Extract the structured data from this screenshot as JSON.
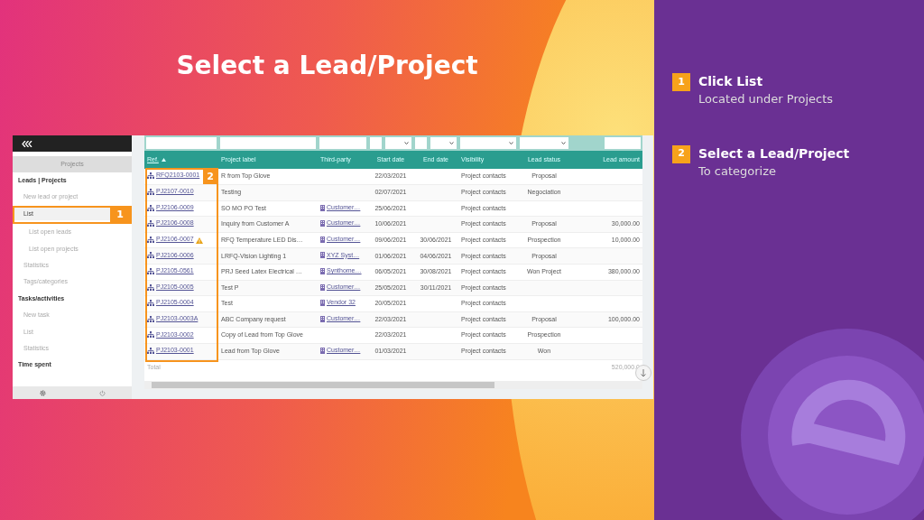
{
  "slide_title": "Select a Lead/Project",
  "sidebar": {
    "header": "Projects",
    "items": [
      {
        "kind": "section",
        "label": "Leads | Projects",
        "selected": false
      },
      {
        "kind": "item",
        "label": "New lead or project",
        "selected": false
      },
      {
        "kind": "item",
        "label": "List",
        "selected": true
      },
      {
        "kind": "subitem",
        "label": "List open leads",
        "selected": false
      },
      {
        "kind": "subitem",
        "label": "List open projects",
        "selected": false
      },
      {
        "kind": "item",
        "label": "Statistics",
        "selected": false
      },
      {
        "kind": "item",
        "label": "Tags/categories",
        "selected": false
      },
      {
        "kind": "section",
        "label": "Tasks/activities",
        "selected": false
      },
      {
        "kind": "item",
        "label": "New task",
        "selected": false
      },
      {
        "kind": "item",
        "label": "List",
        "selected": false
      },
      {
        "kind": "item",
        "label": "Statistics",
        "selected": false
      },
      {
        "kind": "section",
        "label": "Time spent",
        "selected": false
      }
    ]
  },
  "callouts": [
    {
      "number": "1"
    },
    {
      "number": "2"
    }
  ],
  "table": {
    "filters": [
      {
        "kind": "text"
      },
      {
        "kind": "text"
      },
      {
        "kind": "text"
      },
      {
        "kind": "date"
      },
      {
        "kind": "date"
      },
      {
        "kind": "select"
      },
      {
        "kind": "select"
      },
      {
        "kind": "text"
      }
    ],
    "columns": [
      {
        "label": "Ref.",
        "sorted": true
      },
      {
        "label": "Project label",
        "sorted": false
      },
      {
        "label": "Third-party",
        "sorted": false
      },
      {
        "label": "Start date",
        "sorted": false
      },
      {
        "label": "End date",
        "sorted": false
      },
      {
        "label": "Visibility",
        "sorted": false
      },
      {
        "label": "Lead status",
        "sorted": false
      },
      {
        "label": "Lead amount",
        "sorted": false
      }
    ],
    "rows": [
      {
        "ref": "RFQ2103-0001",
        "warning": false,
        "label": "R from Top Glove",
        "third_party": "",
        "start": "22/03/2021",
        "end": "",
        "visibility": "Project contacts",
        "status": "Proposal",
        "amount": ""
      },
      {
        "ref": "PJ2107-0010",
        "warning": false,
        "label": "Testing",
        "third_party": "",
        "start": "02/07/2021",
        "end": "",
        "visibility": "Project contacts",
        "status": "Negociation",
        "amount": ""
      },
      {
        "ref": "PJ2106-0009",
        "warning": false,
        "label": "SO MO PO Test",
        "third_party": "Customer…",
        "start": "25/06/2021",
        "end": "",
        "visibility": "Project contacts",
        "status": "",
        "amount": ""
      },
      {
        "ref": "PJ2106-0008",
        "warning": false,
        "label": "Inquiry from Customer A",
        "third_party": "Customer…",
        "start": "10/06/2021",
        "end": "",
        "visibility": "Project contacts",
        "status": "Proposal",
        "amount": "30,000.00"
      },
      {
        "ref": "PJ2106-0007",
        "warning": true,
        "label": "RFQ Temperature LED Dis…",
        "third_party": "Customer…",
        "start": "09/06/2021",
        "end": "30/06/2021",
        "visibility": "Project contacts",
        "status": "Prospection",
        "amount": "10,000.00"
      },
      {
        "ref": "PJ2106-0006",
        "warning": false,
        "label": "LRFQ-Vision Lighting 1",
        "third_party": "XYZ Syst…",
        "start": "01/06/2021",
        "end": "04/06/2021",
        "visibility": "Project contacts",
        "status": "Proposal",
        "amount": ""
      },
      {
        "ref": "PJ2105-0561",
        "warning": false,
        "label": "PRJ Seed Latex Electrical …",
        "third_party": "Synthome…",
        "start": "06/05/2021",
        "end": "30/08/2021",
        "visibility": "Project contacts",
        "status": "Won Project",
        "amount": "380,000.00"
      },
      {
        "ref": "PJ2105-0005",
        "warning": false,
        "label": "Test P",
        "third_party": "Customer…",
        "start": "25/05/2021",
        "end": "30/11/2021",
        "visibility": "Project contacts",
        "status": "",
        "amount": ""
      },
      {
        "ref": "PJ2105-0004",
        "warning": false,
        "label": "Test",
        "third_party": "Vendor 32",
        "start": "20/05/2021",
        "end": "",
        "visibility": "Project contacts",
        "status": "",
        "amount": ""
      },
      {
        "ref": "PJ2103-0003A",
        "warning": false,
        "label": "ABC Company request",
        "third_party": "Customer…",
        "start": "22/03/2021",
        "end": "",
        "visibility": "Project contacts",
        "status": "Proposal",
        "amount": "100,000.00"
      },
      {
        "ref": "PJ2103-0002",
        "warning": false,
        "label": "Copy of Lead from Top Glove",
        "third_party": "",
        "start": "22/03/2021",
        "end": "",
        "visibility": "Project contacts",
        "status": "Prospection",
        "amount": ""
      },
      {
        "ref": "PJ2103-0001",
        "warning": false,
        "label": "Lead from Top Glove",
        "third_party": "Customer…",
        "start": "01/03/2021",
        "end": "",
        "visibility": "Project contacts",
        "status": "Won",
        "amount": ""
      }
    ],
    "total_label": "Total",
    "total_amount": "520,000.0"
  },
  "steps": [
    {
      "number": "1",
      "title": "Click List",
      "subtitle": "Located under Projects"
    },
    {
      "number": "2",
      "title": "Select a Lead/Project",
      "subtitle": "To categorize"
    }
  ]
}
